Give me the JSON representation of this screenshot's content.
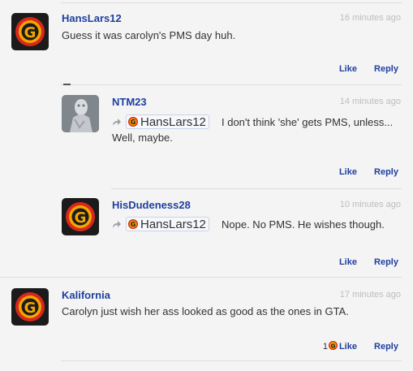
{
  "comments": [
    {
      "username": "HansLars12",
      "time": "16 minutes ago",
      "text": "Guess it was carolyn's PMS day huh.",
      "like": "Like",
      "reply": "Reply"
    },
    {
      "username": "NTM23",
      "time": "14 minutes ago",
      "mention": "HansLars12",
      "text": "I don't think 'she' gets PMS, unless...",
      "text2": "Well, maybe.",
      "like": "Like",
      "reply": "Reply"
    },
    {
      "username": "HisDudeness28",
      "time": "10 minutes ago",
      "mention": "HansLars12",
      "text": "Nope. No PMS. He wishes though.",
      "like": "Like",
      "reply": "Reply"
    },
    {
      "username": "Kalifornia",
      "time": "17 minutes ago",
      "text": "Carolyn just wish her ass looked as good as the ones in GTA.",
      "like_count": "1",
      "like": "Like",
      "reply": "Reply"
    }
  ],
  "colors": {
    "link": "#1e3fa0",
    "timestamp": "#bdbdbd",
    "logo_ring": "#f5a400",
    "logo_red": "#d8281c"
  }
}
